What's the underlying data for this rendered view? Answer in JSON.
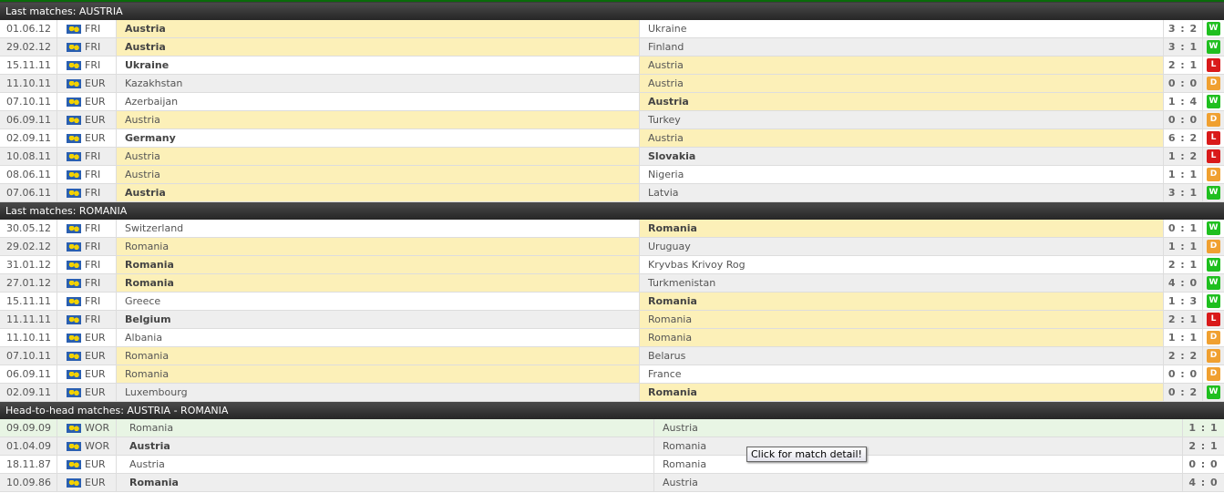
{
  "colors": {
    "W": "#1fbf1f",
    "L": "#d91a1a",
    "D": "#f0a030"
  },
  "sections": [
    {
      "title": "Last matches: AUSTRIA",
      "type": "form",
      "rows": [
        [
          "01.06.12",
          "FRI",
          "Austria",
          "Ukraine",
          "3 : 2",
          "W",
          "h",
          "h"
        ],
        [
          "29.02.12",
          "FRI",
          "Austria",
          "Finland",
          "3 : 1",
          "W",
          "h",
          "h"
        ],
        [
          "15.11.11",
          "FRI",
          "Ukraine",
          "Austria",
          "2 : 1",
          "L",
          "a",
          "h"
        ],
        [
          "11.10.11",
          "EUR",
          "Kazakhstan",
          "Austria",
          "0 : 0",
          "D",
          "a",
          ""
        ],
        [
          "07.10.11",
          "EUR",
          "Azerbaijan",
          "Austria",
          "1 : 4",
          "W",
          "a",
          "a"
        ],
        [
          "06.09.11",
          "EUR",
          "Austria",
          "Turkey",
          "0 : 0",
          "D",
          "h",
          ""
        ],
        [
          "02.09.11",
          "EUR",
          "Germany",
          "Austria",
          "6 : 2",
          "L",
          "a",
          "h"
        ],
        [
          "10.08.11",
          "FRI",
          "Austria",
          "Slovakia",
          "1 : 2",
          "L",
          "h",
          "a"
        ],
        [
          "08.06.11",
          "FRI",
          "Austria",
          "Nigeria",
          "1 : 1",
          "D",
          "h",
          ""
        ],
        [
          "07.06.11",
          "FRI",
          "Austria",
          "Latvia",
          "3 : 1",
          "W",
          "h",
          "h"
        ]
      ]
    },
    {
      "title": "Last matches: ROMANIA",
      "type": "form",
      "rows": [
        [
          "30.05.12",
          "FRI",
          "Switzerland",
          "Romania",
          "0 : 1",
          "W",
          "a",
          "a"
        ],
        [
          "29.02.12",
          "FRI",
          "Romania",
          "Uruguay",
          "1 : 1",
          "D",
          "h",
          ""
        ],
        [
          "31.01.12",
          "FRI",
          "Romania",
          "Kryvbas Krivoy Rog",
          "2 : 1",
          "W",
          "h",
          "h"
        ],
        [
          "27.01.12",
          "FRI",
          "Romania",
          "Turkmenistan",
          "4 : 0",
          "W",
          "h",
          "h"
        ],
        [
          "15.11.11",
          "FRI",
          "Greece",
          "Romania",
          "1 : 3",
          "W",
          "a",
          "a"
        ],
        [
          "11.11.11",
          "FRI",
          "Belgium",
          "Romania",
          "2 : 1",
          "L",
          "a",
          "h"
        ],
        [
          "11.10.11",
          "EUR",
          "Albania",
          "Romania",
          "1 : 1",
          "D",
          "a",
          ""
        ],
        [
          "07.10.11",
          "EUR",
          "Romania",
          "Belarus",
          "2 : 2",
          "D",
          "h",
          ""
        ],
        [
          "06.09.11",
          "EUR",
          "Romania",
          "France",
          "0 : 0",
          "D",
          "h",
          ""
        ],
        [
          "02.09.11",
          "EUR",
          "Luxembourg",
          "Romania",
          "0 : 2",
          "W",
          "a",
          "a"
        ]
      ]
    },
    {
      "title": "Head-to-head matches: AUSTRIA - ROMANIA",
      "type": "h2h",
      "rows": [
        [
          "09.09.09",
          "WOR",
          "Romania",
          "Austria",
          "1 : 1",
          "",
          "",
          ""
        ],
        [
          "01.04.09",
          "WOR",
          "Austria",
          "Romania",
          "2 : 1",
          "",
          "",
          "h"
        ],
        [
          "18.11.87",
          "EUR",
          "Austria",
          "Romania",
          "0 : 0",
          "",
          "",
          ""
        ],
        [
          "10.09.86",
          "EUR",
          "Romania",
          "Austria",
          "4 : 0",
          "",
          "",
          "h"
        ]
      ]
    }
  ],
  "tooltip": "Click for match detail!"
}
